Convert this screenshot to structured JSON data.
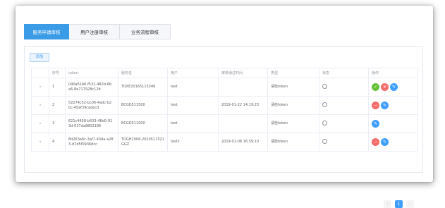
{
  "tabs": [
    {
      "label": "服务申请审核",
      "active": true
    },
    {
      "label": "用户注册审核",
      "active": false
    },
    {
      "label": "业务流程审核",
      "active": false
    }
  ],
  "add_button_label": "添加",
  "table": {
    "headers": [
      "",
      "序号",
      "token",
      "服务名",
      "用户",
      "审核通过时间",
      "类型",
      "状态",
      "操作"
    ],
    "rows": [
      {
        "expand": "›",
        "index": "1",
        "token": "040a61b6-f532-482d-6b a6-8e717928c12d",
        "service": "TOXE20165113246",
        "user": "test",
        "approved_time": "",
        "type": "请检token",
        "actions": [
          "approve",
          "reject",
          "edit"
        ]
      },
      {
        "expand": "›",
        "index": "2",
        "token": "52274c52-bc06-4adc-b2 bc-45af39cadecd",
        "service": "BCGD511500",
        "user": "test",
        "approved_time": "2019-01-22 14:19:23",
        "type": "请检token",
        "actions": [
          "disable",
          "edit"
        ]
      },
      {
        "expand": "›",
        "index": "3",
        "token": "621c4458-b503-48d0-91 3d-037da8802186",
        "service": "BCGD511500",
        "user": "test",
        "approved_time": "",
        "type": "请检token",
        "actions": [
          "edit"
        ]
      },
      {
        "expand": "›",
        "index": "4",
        "token": "8d263e6c-3af7-43da-a28 3-d7d5f0936dcc",
        "service": "TDGH2006-2020511521 GGZ",
        "user": "test2",
        "approved_time": "2019-01-08 16:59:10",
        "type": "请检token",
        "actions": [
          "disable",
          "edit"
        ]
      }
    ]
  },
  "pagination": {
    "prev": "‹",
    "current": "1",
    "next": "›"
  },
  "colors": {
    "accent": "#3a9be6",
    "approve": "#67c23a",
    "reject": "#f56c6c",
    "edit": "#409eff"
  },
  "icons": {
    "approve": "✓",
    "reject": "✕",
    "disable": "−",
    "edit": "✎"
  }
}
